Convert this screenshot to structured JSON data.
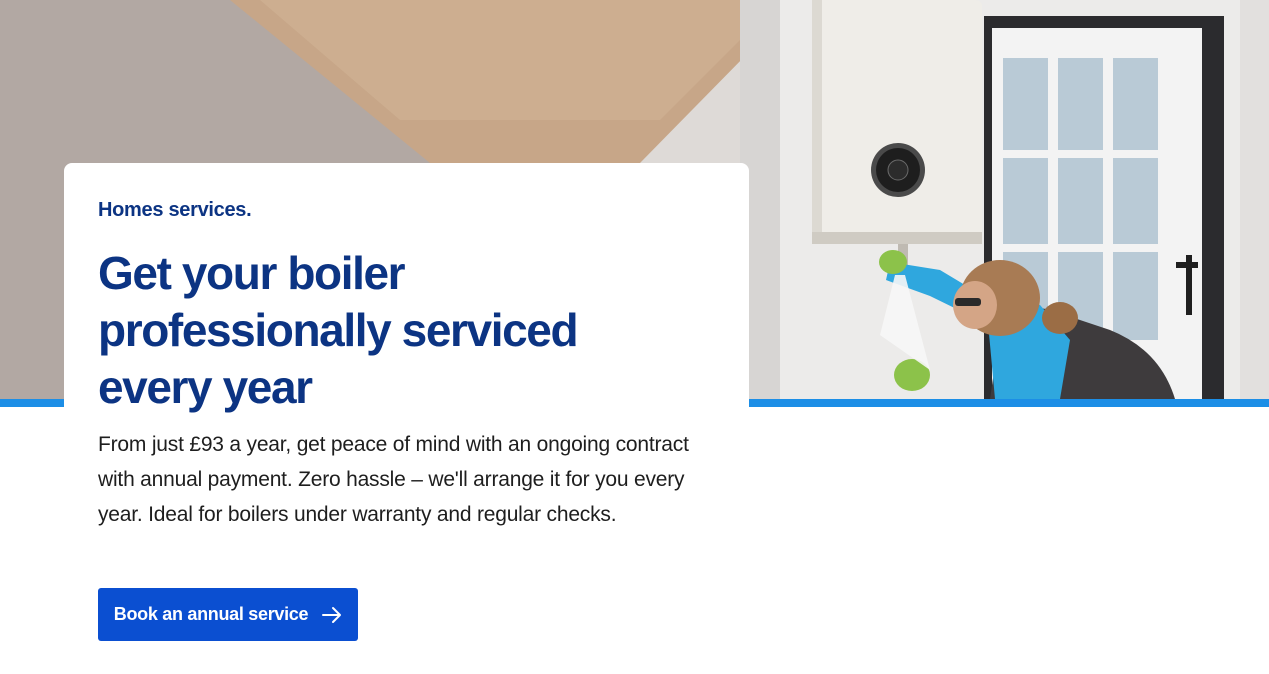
{
  "promo": {
    "eyebrow": "Homes services.",
    "headline": "Get your boiler professionally serviced every year",
    "description": "From just £93 a year, get peace of mind with an ongoing contract with annual payment. Zero hassle – we'll arrange it for you every year. Ideal for boilers under warranty and regular checks.",
    "cta_label": "Book an annual service",
    "cta_icon": "arrow-right-icon"
  },
  "colors": {
    "brand_navy": "#0c3483",
    "button_blue": "#0b4fd1",
    "stripe_blue": "#1c8ee6"
  }
}
